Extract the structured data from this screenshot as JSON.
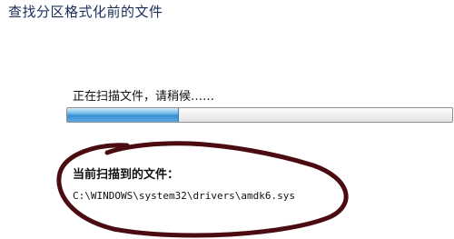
{
  "window": {
    "title": "查找分区格式化前的文件"
  },
  "scan": {
    "status": "正在扫描文件，请稍候……",
    "progress_fraction": 0.29,
    "current_file_label": "当前扫描到的文件：",
    "current_file_path": "C:\\WINDOWS\\system32\\drivers\\amdk6.sys"
  },
  "colors": {
    "title": "#1a2d5a",
    "progress_fill": "#3b90d3",
    "annotation_marker": "#4a0c10"
  }
}
